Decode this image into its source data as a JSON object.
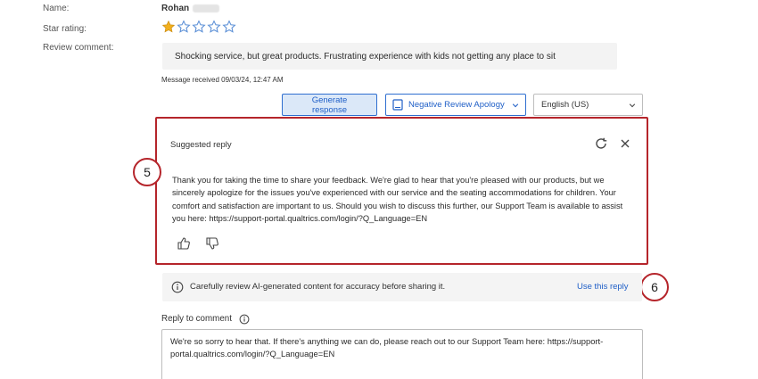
{
  "fields": {
    "name_label": "Name:",
    "name_value": "Rohan",
    "star_label": "Star rating:",
    "comment_label": "Review comment:"
  },
  "rating": {
    "value": 1,
    "max": 5,
    "filled_color": "#f2b01e",
    "empty_color": "#5b8fd6"
  },
  "review": {
    "comment": "Shocking service, but great products. Frustrating  experience with kids not getting any place to sit",
    "received": "Message received 09/03/24, 12:47 AM"
  },
  "toolbar": {
    "generate_label": "Generate response",
    "template_label": "Negative Review Apology",
    "language_label": "English (US)"
  },
  "suggested": {
    "title": "Suggested reply",
    "body": "Thank you for taking the time to share your feedback. We're glad to hear that you're pleased with our products, but we sincerely apologize for the issues you've experienced with our service and the seating accommodations for children. Your comfort and satisfaction are important to us. Should you wish to discuss this further, our Support Team is available to assist you here: https://support-portal.qualtrics.com/login/?Q_Language=EN",
    "icons": [
      "refresh-icon",
      "close-icon",
      "thumbs-up-icon",
      "thumbs-down-icon"
    ]
  },
  "callouts": {
    "first": "5",
    "second": "6"
  },
  "notice": {
    "text": "Carefully review AI-generated content for accuracy before sharing it.",
    "use_reply": "Use this reply"
  },
  "reply": {
    "label": "Reply to comment",
    "value": "We're so sorry to hear that. If there's anything we can do, please reach out to our Support Team here: https://support-portal.qualtrics.com/login/?Q_Language=EN"
  },
  "colors": {
    "accent": "#2f6fd0",
    "highlight": "#b5252b"
  }
}
